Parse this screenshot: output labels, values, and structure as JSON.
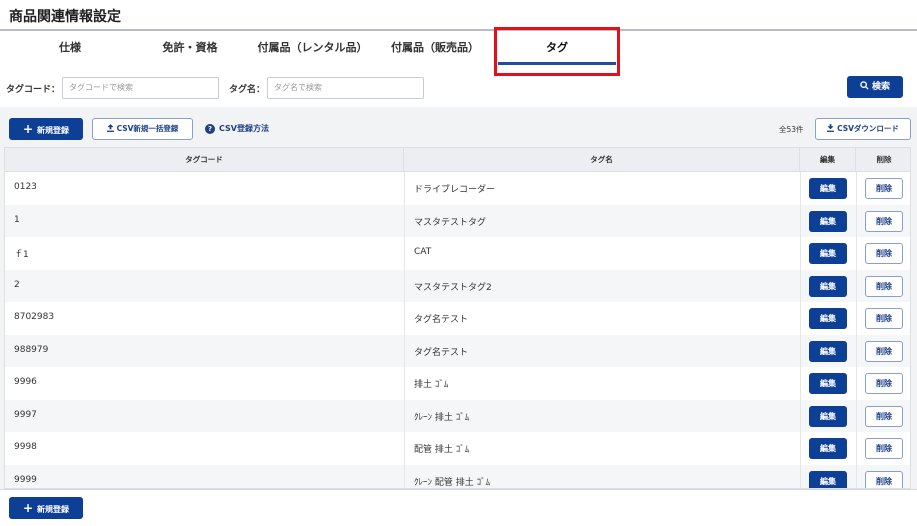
{
  "page": {
    "title": "商品関連情報設定"
  },
  "tabs": [
    {
      "label": "仕様",
      "active": false
    },
    {
      "label": "免許・資格",
      "active": false
    },
    {
      "label": "付属品（レンタル品）",
      "active": false
    },
    {
      "label": "付属品（販売品）",
      "active": false
    },
    {
      "label": "タグ",
      "active": true
    }
  ],
  "search": {
    "tag_code_label": "タグコード：",
    "tag_code_placeholder": "タグコードで検索",
    "tag_name_label": "タグ名：",
    "tag_name_placeholder": "タグ名で検索",
    "search_button": "検索"
  },
  "toolbar": {
    "new_button": "新規登録",
    "csv_bulk_button": "CSV新規一括登録",
    "csv_help_link": "CSV登録方法",
    "total_count": "全53件",
    "csv_download_button": "CSVダウンロード"
  },
  "table": {
    "columns": [
      "タグコード",
      "タグ名",
      "編集",
      "削除"
    ],
    "edit_label": "編集",
    "delete_label": "削除",
    "rows": [
      {
        "code": "0123",
        "name": "ドライブレコーダー"
      },
      {
        "code": "1",
        "name": "マスタテストタグ"
      },
      {
        "code": "ｆ1",
        "name": "CAT"
      },
      {
        "code": "2",
        "name": "マスタテストタグ2"
      },
      {
        "code": "8702983",
        "name": "タグ名テスト"
      },
      {
        "code": "988979",
        "name": "タグ名テスト"
      },
      {
        "code": "9996",
        "name": "排土 ｺﾞﾑ"
      },
      {
        "code": "9997",
        "name": "ｸﾚｰﾝ 排土 ｺﾞﾑ"
      },
      {
        "code": "9998",
        "name": "配管 排土 ｺﾞﾑ"
      },
      {
        "code": "9999",
        "name": "ｸﾚｰﾝ 配管 排土 ｺﾞﾑ"
      }
    ]
  },
  "footer": {
    "new_button": "新規登録"
  },
  "colors": {
    "primary": "#0e3f97",
    "highlight": "#e0101c",
    "tab_underline": "#1d4ea6"
  }
}
